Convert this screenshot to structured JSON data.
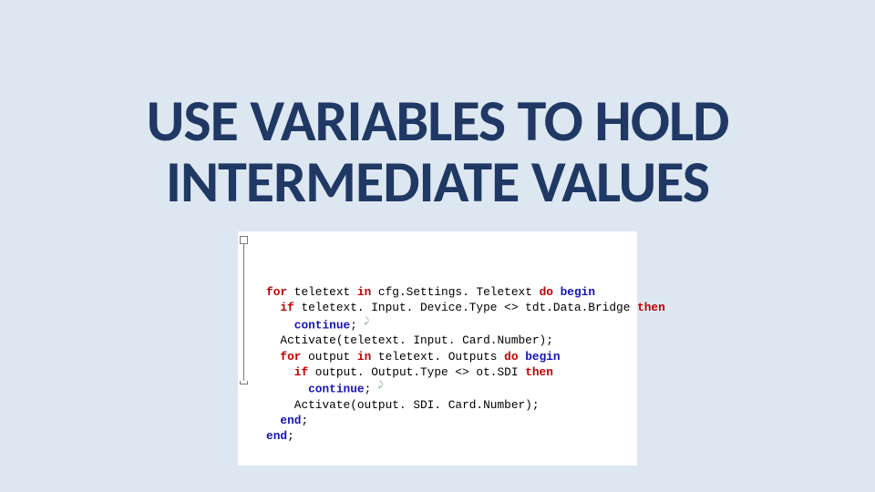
{
  "slide": {
    "title": "USE VARIABLES TO HOLD\nINTERMEDIATE VALUES"
  },
  "code": {
    "lines": [
      {
        "indent": 0,
        "segments": [
          {
            "style": "rdkw",
            "text": "for"
          },
          {
            "style": "txt",
            "text": " teletext "
          },
          {
            "style": "rdkw",
            "text": "in"
          },
          {
            "style": "txt",
            "text": " cfg.Settings. Teletext "
          },
          {
            "style": "rdkw",
            "text": "do"
          },
          {
            "style": "txt",
            "text": " "
          },
          {
            "style": "kw",
            "text": "begin"
          }
        ]
      },
      {
        "indent": 1,
        "segments": [
          {
            "style": "rdkw",
            "text": "if"
          },
          {
            "style": "txt",
            "text": " teletext. Input. Device.Type <> tdt.Data.Bridge "
          },
          {
            "style": "rdkw",
            "text": "then"
          }
        ]
      },
      {
        "indent": 2,
        "segments": [
          {
            "style": "kw",
            "text": "continue"
          },
          {
            "style": "txt",
            "text": "; "
          },
          {
            "style": "para",
            "text": "⤸"
          }
        ]
      },
      {
        "indent": 1,
        "segments": [
          {
            "style": "txt",
            "text": "Activate(teletext. Input. Card.Number);"
          }
        ]
      },
      {
        "indent": 1,
        "segments": [
          {
            "style": "rdkw",
            "text": "for"
          },
          {
            "style": "txt",
            "text": " output "
          },
          {
            "style": "rdkw",
            "text": "in"
          },
          {
            "style": "txt",
            "text": " teletext. Outputs "
          },
          {
            "style": "rdkw",
            "text": "do"
          },
          {
            "style": "txt",
            "text": " "
          },
          {
            "style": "kw",
            "text": "begin"
          }
        ]
      },
      {
        "indent": 2,
        "segments": [
          {
            "style": "rdkw",
            "text": "if"
          },
          {
            "style": "txt",
            "text": " output. Output.Type <> ot.SDI "
          },
          {
            "style": "rdkw",
            "text": "then"
          }
        ]
      },
      {
        "indent": 3,
        "segments": [
          {
            "style": "kw",
            "text": "continue"
          },
          {
            "style": "txt",
            "text": "; "
          },
          {
            "style": "para",
            "text": "⤸"
          }
        ]
      },
      {
        "indent": 2,
        "segments": [
          {
            "style": "txt",
            "text": "Activate(output. SDI. Card.Number);"
          }
        ]
      },
      {
        "indent": 1,
        "segments": [
          {
            "style": "kw",
            "text": "end"
          },
          {
            "style": "txt",
            "text": ";"
          }
        ]
      },
      {
        "indent": 0,
        "segments": [
          {
            "style": "kw",
            "text": "end"
          },
          {
            "style": "txt",
            "text": ";"
          }
        ]
      }
    ]
  }
}
